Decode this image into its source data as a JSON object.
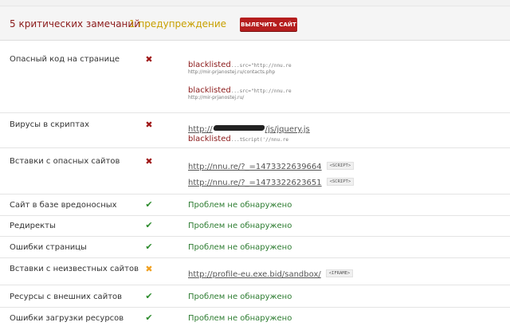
{
  "summary": {
    "critical": "5 критических замечаний",
    "warnings": "1 предупреждение",
    "heal_button": "ВЫЛЕЧИТЬ САЙТ"
  },
  "rows": [
    {
      "name": "Опасный код на странице",
      "status": "critical",
      "details": [
        {
          "keyword": "blacklisted",
          "snippet": "...src=\"http://nnu.re",
          "source": "http://mir-prjanostej.ru/contacts.php"
        },
        {
          "keyword": "blacklisted",
          "snippet": "...src=\"http://nnu.re",
          "source": "http://mir-prjanostej.ru/"
        }
      ]
    },
    {
      "name": "Вирусы в скриптах",
      "status": "critical",
      "details": [
        {
          "link_prefix": "http://",
          "link_suffix": "/js/jquery.js"
        },
        {
          "keyword": "blacklisted",
          "snippet": "...tScript('//nnu.re"
        }
      ]
    },
    {
      "name": "Вставки с опасных сайтов",
      "status": "critical",
      "details": [
        {
          "link": "http://nnu.re/?_=1473322639664",
          "tag": "<SCRIPT>"
        },
        {
          "link": "http://nnu.re/?_=1473322623651",
          "tag": "<SCRIPT>"
        }
      ]
    },
    {
      "name": "Сайт в базе вредоносных",
      "status": "ok",
      "text": "Проблем не обнаружено"
    },
    {
      "name": "Редиректы",
      "status": "ok",
      "text": "Проблем не обнаружено"
    },
    {
      "name": "Ошибки страницы",
      "status": "ok",
      "text": "Проблем не обнаружено"
    },
    {
      "name": "Вставки с неизвестных сайтов",
      "status": "warning",
      "details": [
        {
          "link": "http://profile-eu.exe.bid/sandbox/",
          "tag": "<IFRAME>"
        }
      ]
    },
    {
      "name": "Ресурсы с внешних сайтов",
      "status": "ok",
      "text": "Проблем не обнаружено"
    },
    {
      "name": "Ошибки загрузки ресурсов",
      "status": "ok",
      "text": "Проблем не обнаружено"
    }
  ],
  "icons": {
    "critical": "cross-icon",
    "warning": "cross-icon",
    "ok": "check-icon"
  },
  "colors": {
    "critical": "#a01818",
    "warning": "#f0a020",
    "ok": "#2e7d32",
    "button": "#b51e1e"
  }
}
